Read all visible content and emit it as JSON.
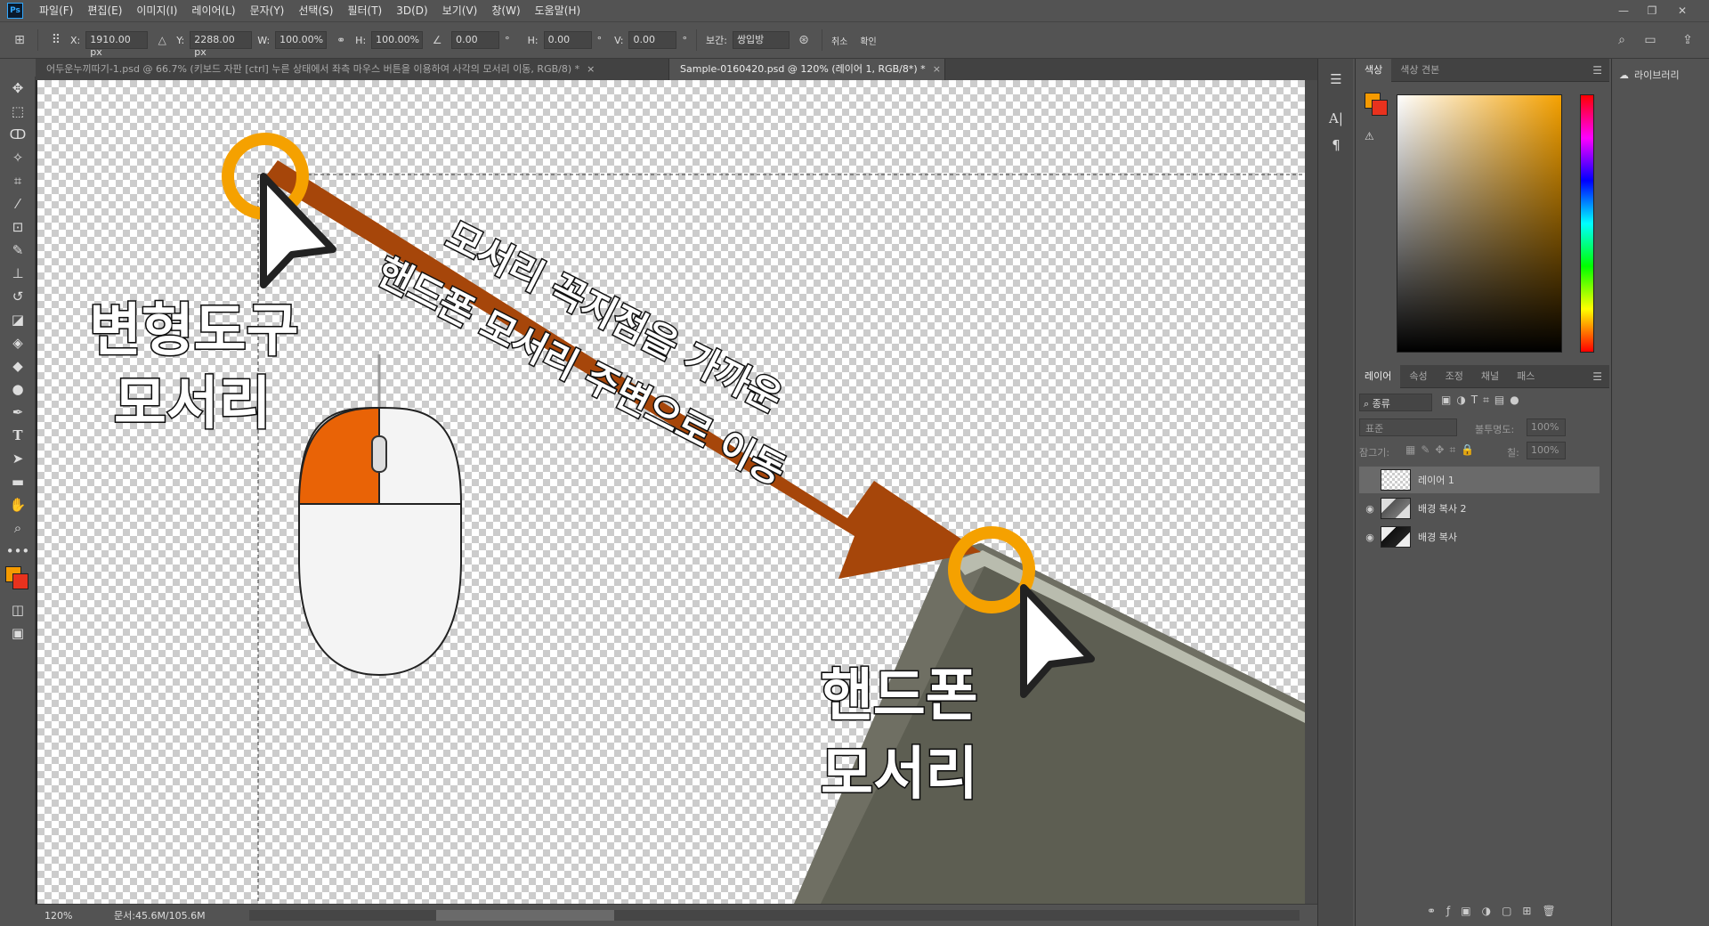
{
  "app": {
    "logo": "Ps"
  },
  "menu": [
    "파일(F)",
    "편집(E)",
    "이미지(I)",
    "레이어(L)",
    "문자(Y)",
    "선택(S)",
    "필터(T)",
    "3D(D)",
    "보기(V)",
    "창(W)",
    "도움말(H)"
  ],
  "options": {
    "x_label": "X:",
    "x_value": "1910.00 px",
    "y_label": "Y:",
    "y_value": "2288.00 px",
    "w_label": "W:",
    "w_value": "100.00%",
    "h_label": "H:",
    "h_value": "100.00%",
    "angle_value": "0.00",
    "hskew_label": "H:",
    "hskew_value": "0.00",
    "vskew_label": "V:",
    "vskew_value": "0.00",
    "deg": "°",
    "interp_label": "보간:",
    "interp_value": "쌍입방",
    "cancel_label": "취소",
    "confirm_label": "확인"
  },
  "tabs": [
    {
      "label": "어두운누끼따기-1.psd @ 66.7% (키보드 자판 [ctrl] 누른 상태에서 좌측 마우스 버튼을 이용하여 사각의 모서리 이동, RGB/8) *",
      "close": "×"
    },
    {
      "label": "Sample-0160420.psd @ 120% (레이어 1, RGB/8*) *",
      "close": "×"
    }
  ],
  "canvas_text": {
    "left_line1": "변형도구",
    "left_line2": "모서리",
    "arrow_line1": "모서리 꼭지점을 가까운",
    "arrow_line2": "핸드폰 모서리 주변으로 이동",
    "right_line1": "핸드폰",
    "right_line2": "모서리"
  },
  "status": {
    "zoom": "120%",
    "doc": "문서:45.6M/105.6M"
  },
  "color_panel": {
    "tab_color": "색상",
    "tab_swatch": "색상 견본",
    "fg_color": "#f59a00",
    "bg_color": "#e8321e"
  },
  "layers_panel": {
    "tabs": [
      "레이어",
      "속성",
      "조정",
      "채널",
      "패스"
    ],
    "filter_label": "종류",
    "blend_mode": "표준",
    "opacity_label": "불투명도:",
    "opacity_value": "100%",
    "lock_label": "잠그기:",
    "fill_label": "칠:",
    "fill_value": "100%",
    "layers": [
      {
        "name": "레이어 1",
        "visible": false,
        "selected": true
      },
      {
        "name": "배경 복사 2",
        "visible": true,
        "selected": false
      },
      {
        "name": "배경 복사",
        "visible": true,
        "selected": false
      }
    ]
  },
  "library": {
    "label": "라이브러리"
  }
}
